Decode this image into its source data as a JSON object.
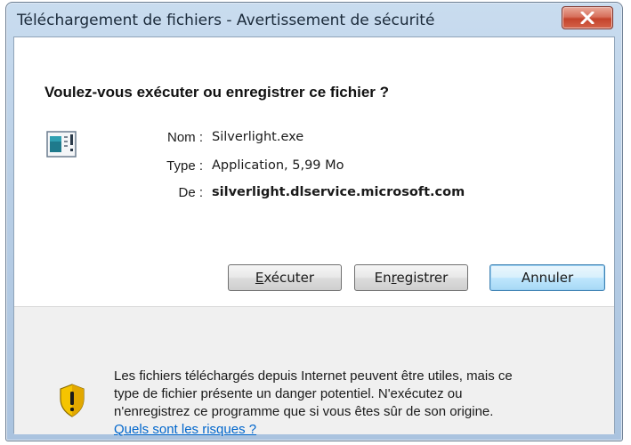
{
  "window": {
    "title": "Téléchargement de fichiers - Avertissement de sécurité"
  },
  "dialog": {
    "question": "Voulez-vous exécuter ou enregistrer ce fichier ?",
    "file_icon": "executable-file-icon",
    "fields": [
      {
        "label": "Nom :",
        "value": "Silverlight.exe"
      },
      {
        "label": "Type :",
        "value": "Application, 5,99 Mo"
      },
      {
        "label": "De :",
        "value": "silverlight.dlservice.microsoft.com"
      }
    ],
    "buttons": {
      "run": {
        "accel": "E",
        "rest": "xécuter"
      },
      "save": {
        "pre": "En",
        "accel": "r",
        "rest": "egistrer"
      },
      "cancel": "Annuler"
    }
  },
  "warning": {
    "icon": "security-shield-icon",
    "lines": [
      "Les fichiers téléchargés depuis Internet peuvent être utiles, mais ce",
      "type de fichier présente un danger potentiel. N'exécutez ou",
      "n'enregistrez ce programme que si vous êtes sûr de son origine."
    ],
    "link": "Quels sont les risques ?"
  },
  "colors": {
    "title_bar": "#b9cfe6",
    "close_button": "#c4432c",
    "link": "#0066cc",
    "shield_yellow": "#f5c400"
  }
}
